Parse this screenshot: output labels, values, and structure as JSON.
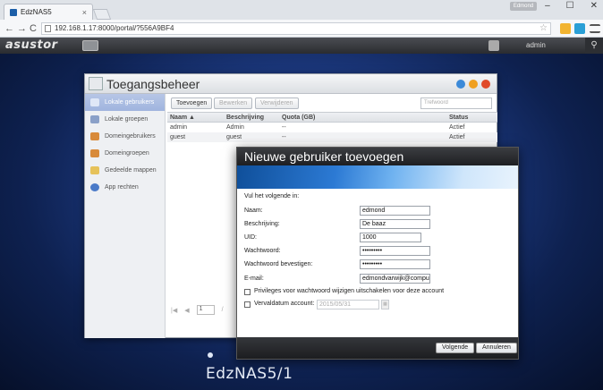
{
  "browser": {
    "tab_title": "EdzNAS5",
    "tab_close": "×",
    "user_badge": "Edmond",
    "win_minimize": "–",
    "win_maximize": "☐",
    "win_close": "✕",
    "back": "←",
    "forward": "→",
    "reload": "C",
    "url": "192.168.1.17:8000/portal/?556A9BF4",
    "star": "☆"
  },
  "topbar": {
    "logo": "asustor",
    "username": "admin",
    "search_glyph": "⚲"
  },
  "desktop": {
    "nas_name": "EdzNAS5/1"
  },
  "window": {
    "title": "Toegangsbeheer",
    "sidebar": [
      {
        "label": "Lokale gebruikers",
        "active": true
      },
      {
        "label": "Lokale groepen",
        "active": false
      },
      {
        "label": "Domeingebruikers",
        "active": false
      },
      {
        "label": "Domeingroepen",
        "active": false
      },
      {
        "label": "Gedeelde mappen",
        "active": false
      },
      {
        "label": "App rechten",
        "active": false
      }
    ],
    "toolbar": {
      "add": "Toevoegen",
      "edit": "Bewerken",
      "remove": "Verwijderen",
      "filter_placeholder": "Trefwoord"
    },
    "table": {
      "headers": [
        "Naam  ▲",
        "Beschrijving",
        "Quota (GB)",
        "Status"
      ],
      "rows": [
        [
          "admin",
          "Admin",
          "--",
          "Actief"
        ],
        [
          "guest",
          "guest",
          "--",
          "Actief"
        ]
      ]
    },
    "pager": {
      "first": "|◀",
      "prev": "◀",
      "page": "1",
      "sep": "/"
    }
  },
  "dialog": {
    "title": "Nieuwe gebruiker toevoegen",
    "intro": "Vul het volgende in:",
    "name_label": "Naam:",
    "name_value": "edmond",
    "desc_label": "Beschrijving:",
    "desc_value": "De baaz",
    "uid_label": "UID:",
    "uid_value": "1000",
    "pw_label": "Wachtwoord:",
    "pw_value": "•••••••••",
    "pw2_label": "Wachtwoord bevestigen:",
    "pw2_value": "•••••••••",
    "email_label": "E-mail:",
    "email_value": "edmondvarwijk@compu",
    "privileges_label": "Privileges voor wachtwoord wijzigen uitschakelen voor deze account",
    "expiry_label": "Vervaldatum account:",
    "expiry_value": "2015/05/31",
    "next_btn": "Volgende",
    "cancel_btn": "Annuleren"
  }
}
